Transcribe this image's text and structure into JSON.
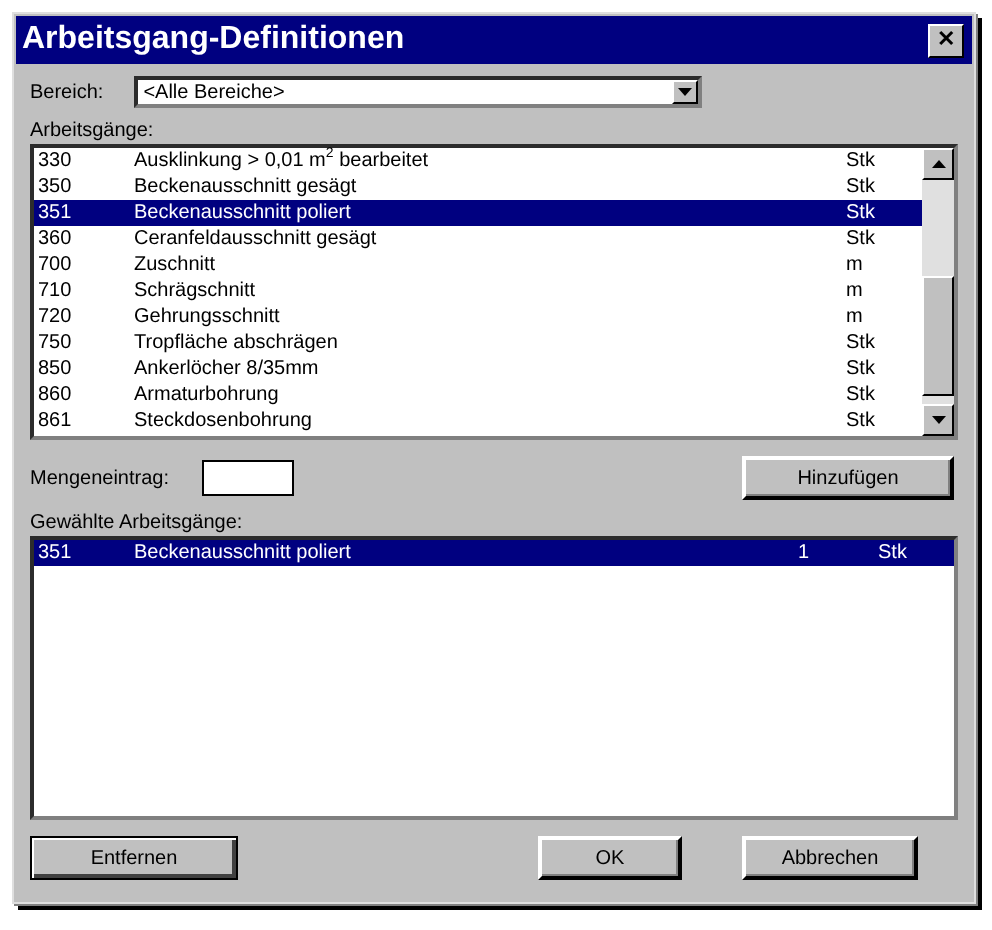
{
  "window": {
    "title": "Arbeitsgang-Definitionen",
    "close": "✕"
  },
  "bereich": {
    "label": "Bereich:",
    "value": "<Alle Bereiche>"
  },
  "arbeitsgaenge": {
    "label": "Arbeitsgänge:",
    "rows": [
      {
        "code": "330",
        "name": "Ausklinkung > 0,01 m$^{2}$ bearbeitet",
        "unit": "Stk",
        "selected": false
      },
      {
        "code": "350",
        "name": "Beckenausschnitt gesägt",
        "unit": "Stk",
        "selected": false
      },
      {
        "code": "351",
        "name": "Beckenausschnitt poliert",
        "unit": "Stk",
        "selected": true
      },
      {
        "code": "360",
        "name": "Ceranfeldausschnitt gesägt",
        "unit": "Stk",
        "selected": false
      },
      {
        "code": "700",
        "name": "Zuschnitt",
        "unit": "m",
        "selected": false
      },
      {
        "code": "710",
        "name": "Schrägschnitt",
        "unit": "m",
        "selected": false
      },
      {
        "code": "720",
        "name": "Gehrungsschnitt",
        "unit": "m",
        "selected": false
      },
      {
        "code": "750",
        "name": "Tropfläche abschrägen",
        "unit": "Stk",
        "selected": false
      },
      {
        "code": "850",
        "name": "Ankerlöcher 8/35mm",
        "unit": "Stk",
        "selected": false
      },
      {
        "code": "860",
        "name": "Armaturbohrung",
        "unit": "Stk",
        "selected": false
      },
      {
        "code": "861",
        "name": "Steckdosenbohrung",
        "unit": "Stk",
        "selected": false
      }
    ]
  },
  "mengeneintrag": {
    "label": "Mengeneintrag:"
  },
  "add_button": "Hinzufügen",
  "gewaehlte": {
    "label": "Gewählte Arbeitsgänge:",
    "rows": [
      {
        "code": "351",
        "name": "Beckenausschnitt poliert",
        "qty": "1",
        "unit": "Stk",
        "selected": true
      }
    ]
  },
  "buttons": [
    {
      "label": "Entfernen",
      "focused": true
    },
    {
      "label": "OK",
      "focused": false
    },
    {
      "label": "Abbrechen",
      "focused": false
    }
  ]
}
